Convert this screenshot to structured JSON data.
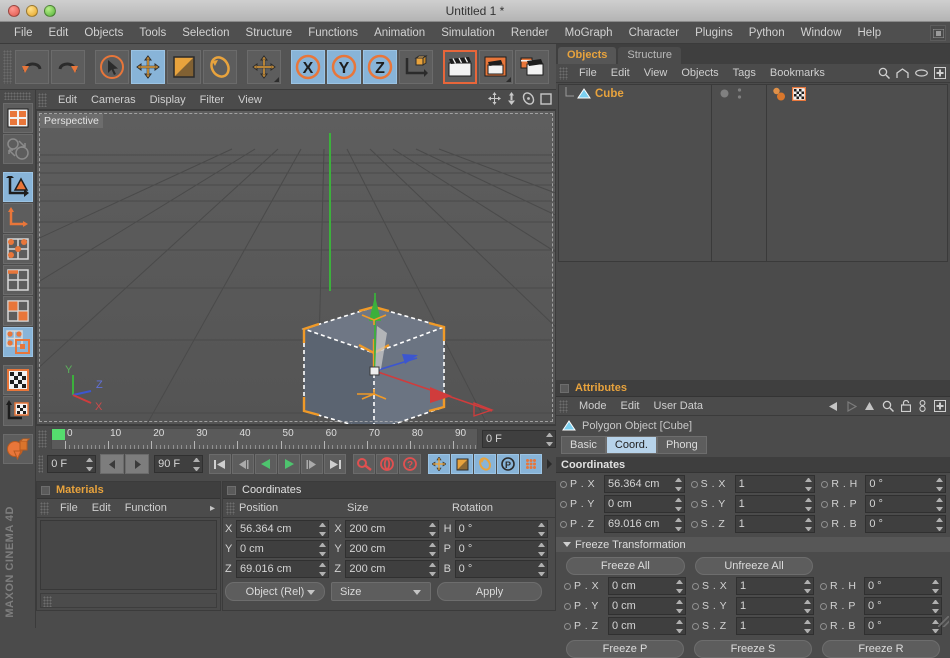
{
  "window": {
    "title": "Untitled 1 *"
  },
  "menubar": {
    "items": [
      "File",
      "Edit",
      "Objects",
      "Tools",
      "Selection",
      "Structure",
      "Functions",
      "Animation",
      "Simulation",
      "Render",
      "MoGraph",
      "Character",
      "Plugins",
      "Python",
      "Window",
      "Help"
    ],
    "layout_icon": "layout-icon"
  },
  "toolbar": {
    "buttons": [
      {
        "name": "undo-button",
        "icon": "undo-icon",
        "state": "normal"
      },
      {
        "name": "redo-button",
        "icon": "redo-icon",
        "state": "normal"
      },
      {
        "name": "live-selection-button",
        "icon": "cursor-circle-icon",
        "state": "normal"
      },
      {
        "name": "move-tool-button",
        "icon": "move-icon",
        "state": "selected"
      },
      {
        "name": "scale-tool-button",
        "icon": "scale-icon",
        "state": "normal"
      },
      {
        "name": "rotate-tool-button",
        "icon": "rotate-icon",
        "state": "normal"
      },
      {
        "name": "move-axis-button",
        "icon": "move-plus-icon",
        "state": "normal"
      },
      {
        "name": "x-axis-lock-button",
        "icon": "x-axis-icon",
        "state": "selected",
        "label": "X"
      },
      {
        "name": "y-axis-lock-button",
        "icon": "y-axis-icon",
        "state": "selected",
        "label": "Y"
      },
      {
        "name": "z-axis-lock-button",
        "icon": "z-axis-icon",
        "state": "selected",
        "label": "Z"
      },
      {
        "name": "world-object-coord-button",
        "icon": "axis-cube-icon",
        "state": "normal"
      },
      {
        "name": "render-view-button",
        "icon": "clapper-icon",
        "state": "highlighted"
      },
      {
        "name": "render-region-button",
        "icon": "clapper-region-icon",
        "state": "normal"
      },
      {
        "name": "render-settings-button",
        "icon": "render-settings-icon",
        "state": "normal"
      },
      {
        "name": "add-cube-button",
        "icon": "cube-icon",
        "state": "normal"
      }
    ]
  },
  "leftbar": {
    "buttons": [
      {
        "name": "layout-tool-button",
        "icon": "grid-layout-icon",
        "state": "normal"
      },
      {
        "name": "undo-view-button",
        "icon": "globe-undo-icon",
        "state": "normal"
      },
      {
        "name": "model-mode-button",
        "icon": "model-axis-icon",
        "state": "selected"
      },
      {
        "name": "object-axis-button",
        "icon": "object-axis-icon",
        "state": "normal"
      },
      {
        "name": "point-mode-button",
        "icon": "points-icon",
        "state": "normal"
      },
      {
        "name": "edge-mode-button",
        "icon": "edges-icon",
        "state": "normal"
      },
      {
        "name": "polygon-mode-button",
        "icon": "polygons-icon",
        "state": "normal"
      },
      {
        "name": "uv-mode-button",
        "icon": "uv-polygons-icon",
        "state": "selected"
      },
      {
        "name": "texture-mode-button",
        "icon": "checker-icon",
        "state": "normal"
      },
      {
        "name": "texture-axis-button",
        "icon": "texture-axis-icon",
        "state": "normal"
      },
      {
        "name": "workplane-button",
        "icon": "sphere-cube-cone-icon",
        "state": "normal"
      }
    ],
    "brand": "MAXON CINEMA 4D"
  },
  "viewport": {
    "menu": [
      "Edit",
      "Cameras",
      "Display",
      "Filter",
      "View"
    ],
    "icons": [
      "pan-icon",
      "dolly-icon",
      "orbit-icon",
      "maximize-icon"
    ],
    "label": "Perspective",
    "axis_gizmo": {
      "x": "X",
      "y": "Y",
      "z": "Z"
    },
    "colors": {
      "x_axis": "#d03c3c",
      "y_axis": "#3cc03c",
      "z_axis": "#3c56d0",
      "selection": "#ffffff",
      "cage": "#f09a28"
    }
  },
  "timeline": {
    "ruler_labels": [
      "0",
      "10",
      "20",
      "30",
      "40",
      "50",
      "60",
      "70",
      "80",
      "90"
    ],
    "current_frame_right": "0 F",
    "start_frame": "0 F",
    "end_frame": "90 F",
    "transport": [
      "go-to-start-icon",
      "step-back-icon",
      "play-reverse-icon",
      "play-icon",
      "step-forward-icon",
      "go-to-end-icon"
    ],
    "record_buttons": [
      "record-key-icon",
      "autokey-icon",
      "key-selection-icon"
    ],
    "key_toggles": [
      "position-key-icon",
      "scale-key-icon",
      "rotation-key-icon",
      "param-key-icon",
      "pla-key-icon"
    ]
  },
  "materials": {
    "title": "Materials",
    "menu": [
      "File",
      "Edit",
      "Function"
    ],
    "overflow": "▸"
  },
  "coordinates_panel": {
    "title": "Coordinates",
    "columns": [
      "Position",
      "Size",
      "Rotation"
    ],
    "rows": [
      {
        "pos_label": "X",
        "pos_value": "56.364 cm",
        "size_label": "X",
        "size_value": "200 cm",
        "rot_label": "H",
        "rot_value": "0 °"
      },
      {
        "pos_label": "Y",
        "pos_value": "0 cm",
        "size_label": "Y",
        "size_value": "200 cm",
        "rot_label": "P",
        "rot_value": "0 °"
      },
      {
        "pos_label": "Z",
        "pos_value": "69.016 cm",
        "size_label": "Z",
        "size_value": "200 cm",
        "rot_label": "B",
        "rot_value": "0 °"
      }
    ],
    "mode_select": "Object (Rel)",
    "size_select": "Size",
    "apply_button": "Apply"
  },
  "objects_panel": {
    "tabs": [
      {
        "label": "Objects",
        "active": true
      },
      {
        "label": "Structure",
        "active": false
      }
    ],
    "menu": [
      "File",
      "Edit",
      "View",
      "Objects",
      "Tags",
      "Bookmarks"
    ],
    "header_icons": [
      "search-icon",
      "home-icon",
      "eye-icon",
      "add-icon"
    ],
    "items": [
      {
        "name": "Cube",
        "icon": "polygon-object-icon",
        "tags": [
          "material-tag-icon",
          "texture-tag-icon"
        ]
      }
    ]
  },
  "attributes_panel": {
    "title": "Attributes",
    "menu": [
      "Mode",
      "Edit",
      "User Data"
    ],
    "header_icons": [
      "back-arrow-icon",
      "forward-arrow-icon",
      "up-arrow-icon",
      "search-icon",
      "lock-icon",
      "link-icon",
      "add-icon"
    ],
    "object_title": "Polygon Object [Cube]",
    "tabs": [
      {
        "label": "Basic",
        "active": false
      },
      {
        "label": "Coord.",
        "active": true
      },
      {
        "label": "Phong",
        "active": false
      }
    ],
    "coordinates": {
      "section_title": "Coordinates",
      "rows": [
        {
          "p_label": "P . X",
          "p_value": "56.364 cm",
          "s_label": "S . X",
          "s_value": "1",
          "r_label": "R . H",
          "r_value": "0 °"
        },
        {
          "p_label": "P . Y",
          "p_value": "0 cm",
          "s_label": "S . Y",
          "s_value": "1",
          "r_label": "R . P",
          "r_value": "0 °"
        },
        {
          "p_label": "P . Z",
          "p_value": "69.016 cm",
          "s_label": "S . Z",
          "s_value": "1",
          "r_label": "R . B",
          "r_value": "0 °"
        }
      ]
    },
    "freeze": {
      "section_title": "Freeze Transformation",
      "freeze_all": "Freeze All",
      "unfreeze_all": "Unfreeze All",
      "rows": [
        {
          "p_label": "P . X",
          "p_value": "0 cm",
          "s_label": "S . X",
          "s_value": "1",
          "r_label": "R . H",
          "r_value": "0 °"
        },
        {
          "p_label": "P . Y",
          "p_value": "0 cm",
          "s_label": "S . Y",
          "s_value": "1",
          "r_label": "R . P",
          "r_value": "0 °"
        },
        {
          "p_label": "P . Z",
          "p_value": "0 cm",
          "s_label": "S . Z",
          "s_value": "1",
          "r_label": "R . B",
          "r_value": "0 °"
        }
      ],
      "freeze_p": "Freeze P",
      "freeze_s": "Freeze S",
      "freeze_r": "Freeze R"
    }
  }
}
